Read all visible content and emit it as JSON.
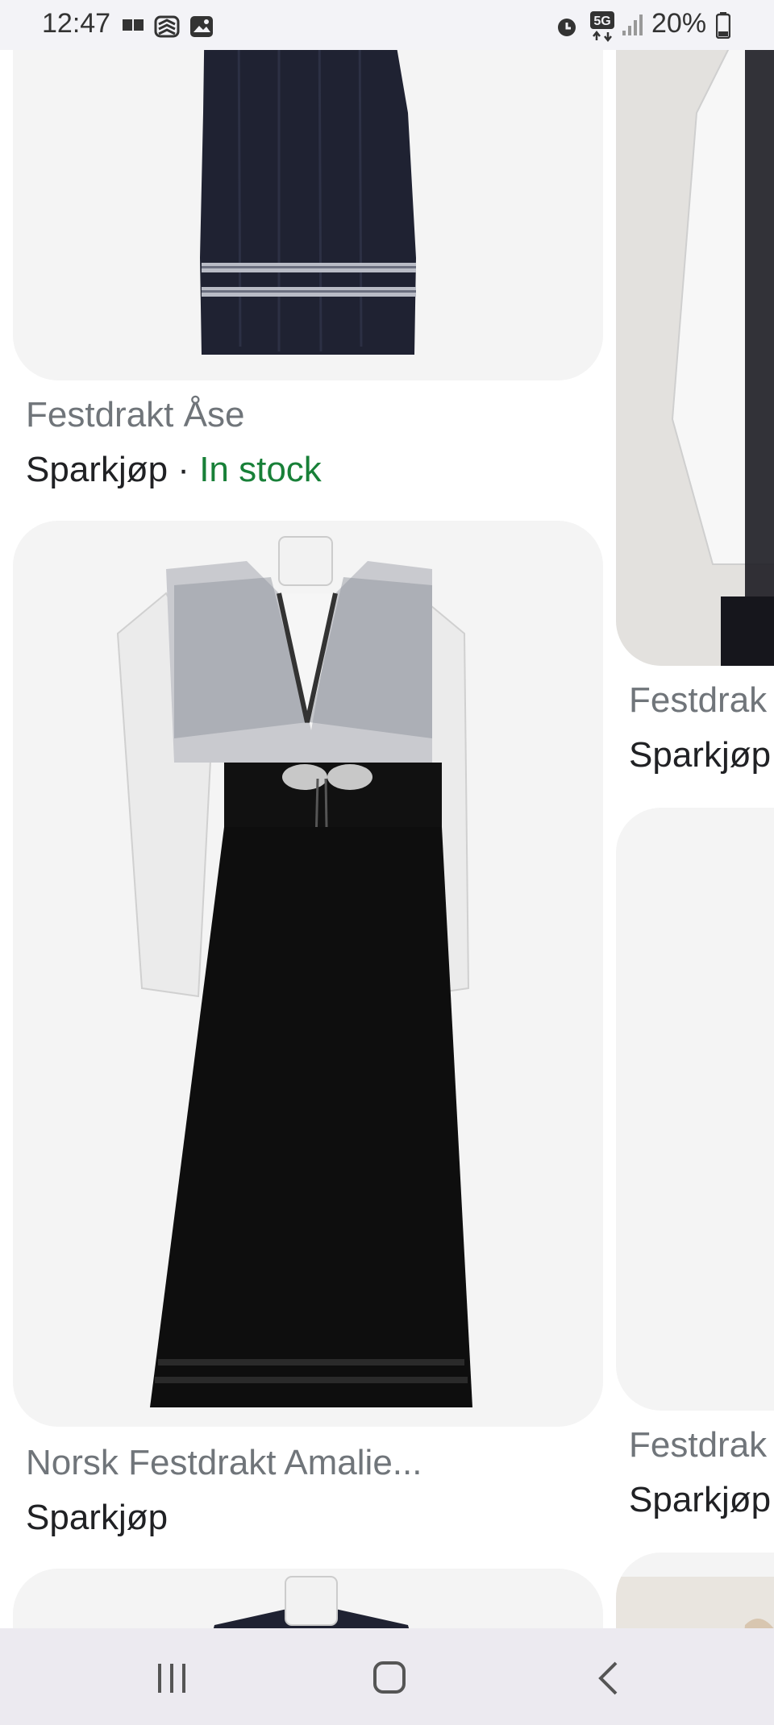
{
  "status": {
    "time": "12:47",
    "battery": "20%",
    "network": "5G"
  },
  "results": [
    {
      "title": "Festdrakt Åse",
      "seller": "Sparkjøp",
      "sep": " · ",
      "stock": "In stock"
    },
    {
      "title": "Norsk Festdrakt Amalie...",
      "seller": "Sparkjøp"
    },
    {
      "title": "Festdrak",
      "seller": "Sparkjøp"
    },
    {
      "title": "Festdrak",
      "seller": "Sparkjøp"
    }
  ],
  "colors": {
    "card_bg": "#f4f4f4",
    "title": "#70757a",
    "seller": "#202124",
    "stock": "#188038"
  }
}
